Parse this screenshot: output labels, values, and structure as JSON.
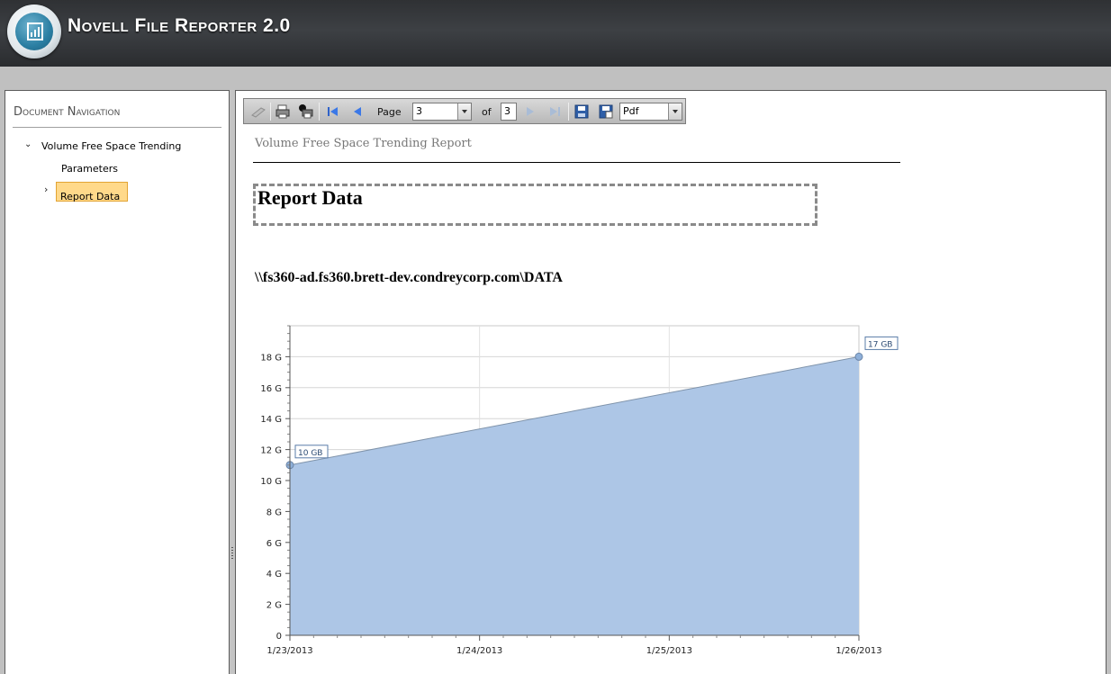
{
  "header": {
    "title": "Novell File Reporter 2.0",
    "logo_icon": "report-chart-icon"
  },
  "navigation": {
    "title": "Document Navigation",
    "items": [
      {
        "label": "Volume Free Space Trending",
        "expanded": true
      },
      {
        "label": "Parameters"
      },
      {
        "label": "Report Data",
        "selected": true
      }
    ]
  },
  "toolbar": {
    "page_label": "Page",
    "current_page": "3",
    "of_label": "of",
    "total_pages": "3",
    "export_format": "Pdf",
    "icons": [
      "document-map-icon",
      "print-icon",
      "print-page-icon",
      "first-page-icon",
      "previous-page-icon",
      "next-page-icon",
      "last-page-icon",
      "save-icon",
      "export-icon"
    ]
  },
  "report": {
    "subtitle": "Volume Free Space Trending Report",
    "section_title": "Report Data",
    "volume_path": "\\\\fs360-ad.fs360.brett-dev.condreycorp.com\\DATA"
  },
  "chart_data": {
    "type": "area",
    "x": [
      "1/23/2013",
      "1/26/2013"
    ],
    "values": [
      11,
      18
    ],
    "point_labels": [
      "10 GB",
      "17 GB"
    ],
    "x_ticks": [
      "1/23/2013",
      "1/24/2013",
      "1/25/2013",
      "1/26/2013"
    ],
    "y_ticks": [
      "0",
      "2 G",
      "4 G",
      "6 G",
      "8 G",
      "10 G",
      "12 G",
      "14 G",
      "16 G",
      "18 G"
    ],
    "ylim": [
      0,
      20
    ],
    "grid": true,
    "fill_color": "#adc6e6",
    "line_color": "#7f93aa"
  }
}
